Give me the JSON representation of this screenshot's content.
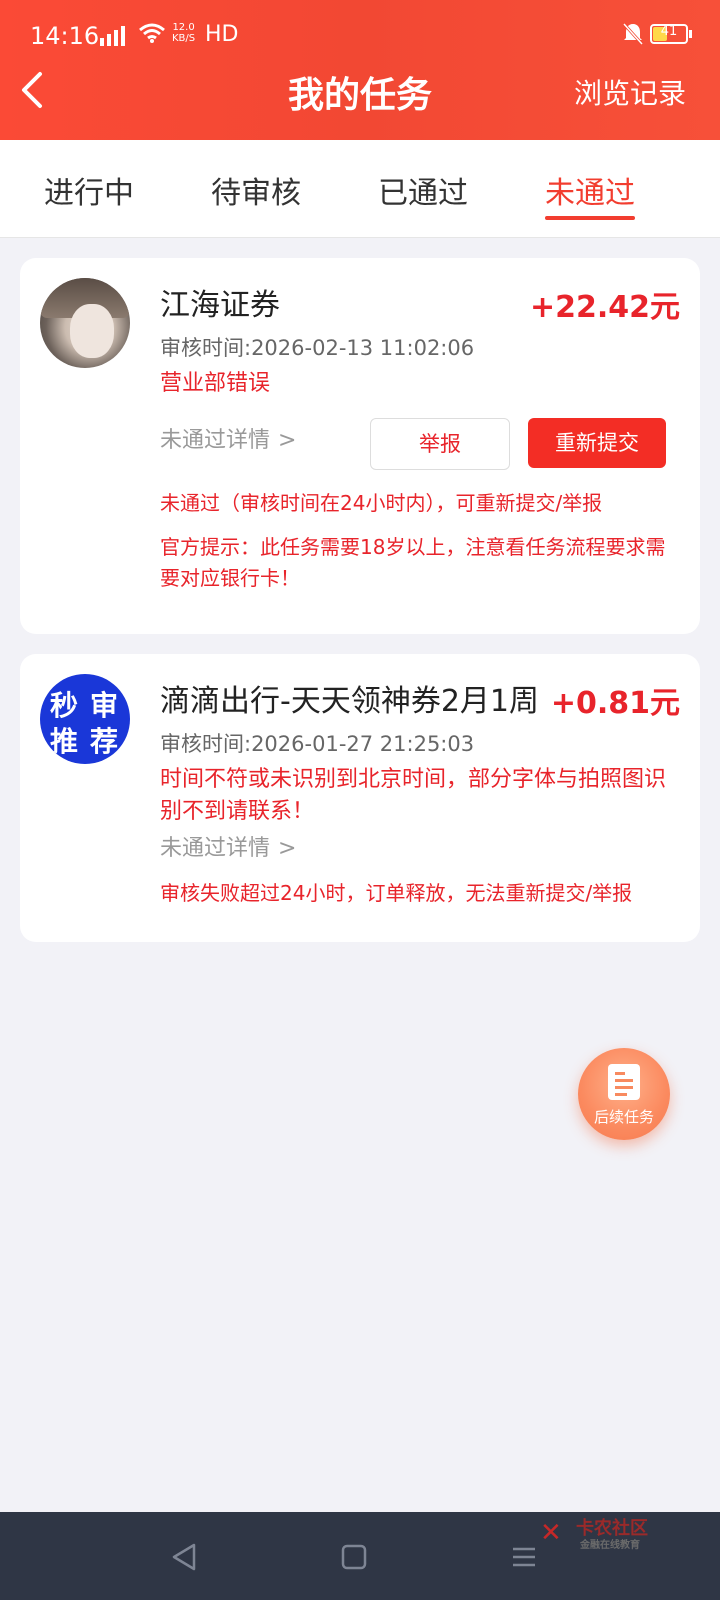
{
  "status_bar": {
    "time": "14:16",
    "signal": "4G",
    "speed_value": "12.0",
    "speed_unit": "KB/S",
    "hd": "HD",
    "battery": "41"
  },
  "header": {
    "back_icon": "chevron-left-icon",
    "title": "我的任务",
    "history": "浏览记录"
  },
  "tabs": [
    {
      "label": "进行中",
      "active": false
    },
    {
      "label": "待审核",
      "active": false
    },
    {
      "label": "已通过",
      "active": false
    },
    {
      "label": "未通过",
      "active": true
    }
  ],
  "tasks": [
    {
      "title": "江海证券",
      "reward": "+22.42元",
      "review_time": "审核时间:2026-02-13 11:02:06",
      "reason": "营业部错误",
      "detail_link": "未通过详情",
      "report_btn": "举报",
      "resubmit_btn": "重新提交",
      "status_note": "未通过（审核时间在24小时内），可重新提交/举报",
      "official_tip": "官方提示：此任务需要18岁以上，注意看任务流程要求需要对应银行卡！"
    },
    {
      "title": "滴滴出行-天天领神券2月1周",
      "reward": "+0.81元",
      "review_time": "审核时间:2026-01-27 21:25:03",
      "reason": "时间不符或未识别到北京时间，部分字体与拍照图识别不到请联系！",
      "detail_link": "未通过详情",
      "status_note": "审核失败超过24小时，订单释放，无法重新提交/举报",
      "avatar_text": [
        "秒",
        "审",
        "推",
        "荐"
      ]
    }
  ],
  "fab": {
    "label": "后续任务",
    "icon": "document-icon"
  },
  "watermark": {
    "title": "卡农社区",
    "subtitle": "金融在线教育"
  },
  "colors": {
    "accent": "#f23d2f",
    "header": "#f24833",
    "reward": "#e8242b",
    "background": "#f2f2f7"
  }
}
